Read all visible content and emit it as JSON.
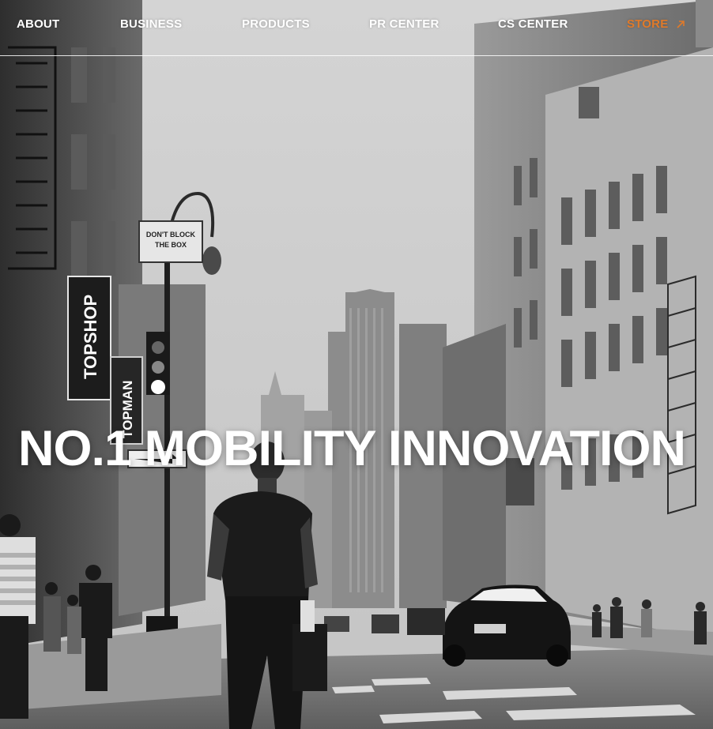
{
  "nav": {
    "items": [
      {
        "label": "ABOUT"
      },
      {
        "label": "BUSINESS"
      },
      {
        "label": "PRODUCTS"
      },
      {
        "label": "PR CENTER"
      },
      {
        "label": "CS CENTER"
      }
    ],
    "store": {
      "label": "STORE",
      "icon": "external-arrow-icon",
      "color": "#e07a2a"
    }
  },
  "hero": {
    "headline": "NO.1 MOBILITY INNOVATION",
    "signs": {
      "topshop": "TOPSHOP",
      "topman": "TOPMAN",
      "street_sign_line1": "DON'T BLOCK",
      "street_sign_line2": "THE BOX"
    }
  }
}
